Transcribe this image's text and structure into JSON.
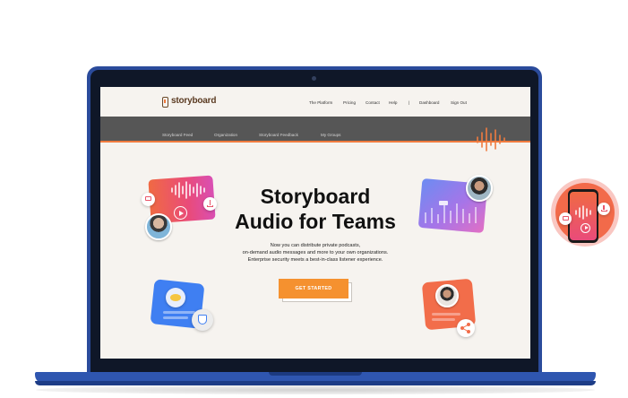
{
  "app": {
    "logo_text": "storyboard"
  },
  "nav": {
    "items": [
      "The Platform",
      "Pricing",
      "Contact",
      "Help"
    ],
    "separator": "|",
    "right_items": [
      "Dashboard",
      "Sign Out"
    ]
  },
  "subnav": {
    "items": [
      "Storyboard Feed",
      "Organization",
      "Storyboard Feedback",
      "My Groups"
    ]
  },
  "hero": {
    "title_line1": "Storyboard",
    "title_line2": "Audio for Teams",
    "description_lines": [
      "Now you can distribute private podcasts,",
      "on-demand audio messages and more to your own organizations.",
      "Enterprise security meets a best-in-class listener experience."
    ],
    "cta_label": "GET STARTED"
  },
  "icons": {
    "audio_card": [
      "chat-icon",
      "play-icon",
      "download-icon",
      "waveform-icon"
    ],
    "chart_card": [
      "chart-icon"
    ],
    "blue_card": [
      "reaction-icon",
      "shield-icon"
    ],
    "orange_card": [
      "share-icon"
    ],
    "phone_badge": [
      "chat-icon",
      "waveform-icon",
      "play-icon",
      "download-icon"
    ]
  },
  "colors": {
    "accent_orange": "#f5912f",
    "subnav_bg": "#565656",
    "laptop_blue": "#2f56b0",
    "brand_brown": "#5b3b22"
  }
}
